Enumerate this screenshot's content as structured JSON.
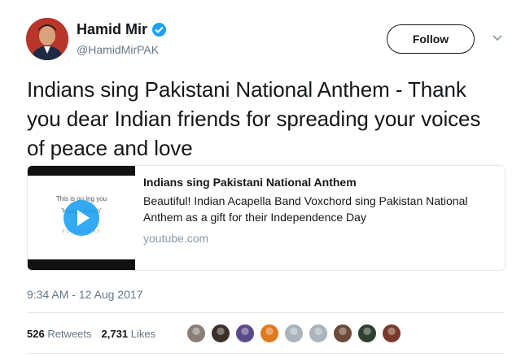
{
  "user": {
    "display_name": "Hamid Mir",
    "handle": "@HamidMirPAK",
    "verified": true
  },
  "actions": {
    "follow_label": "Follow",
    "menu_icon": "chevron-down-icon"
  },
  "tweet": {
    "text": "Indians sing Pakistani National Anthem - Thank you dear Indian friends for spreading your voices of peace and love",
    "timestamp": "9:34 AM - 12 Aug 2017"
  },
  "card": {
    "title": "Indians sing Pakistani National Anthem",
    "description": "Beautiful! Indian Acapella Band Voxchord sing Pakistan National Anthem as a gift for their Independence Day",
    "domain": "youtube.com",
    "thumbnail_line1": "This is ou          ing you",
    "thumbnail_line2": "'Happy              kistan'",
    "thumbnail_line3": "VOICE              4092",
    "play_icon": "play-icon"
  },
  "stats": {
    "retweets_count": "526",
    "retweets_label": "Retweets",
    "likes_count": "2,731",
    "likes_label": "Likes"
  },
  "likers": [
    {
      "color": "#8a7f78"
    },
    {
      "color": "#3b2f2a"
    },
    {
      "color": "#5a4a8a"
    },
    {
      "color": "#e07a20"
    },
    {
      "color": "#a9b4bd"
    },
    {
      "color": "#a9b4bd"
    },
    {
      "color": "#6b4a3a"
    },
    {
      "color": "#2f3f2f"
    },
    {
      "color": "#7a3a2a"
    }
  ],
  "colors": {
    "accent": "#1da1f2",
    "secondary_text": "#657786",
    "border": "#e1e8ed"
  }
}
